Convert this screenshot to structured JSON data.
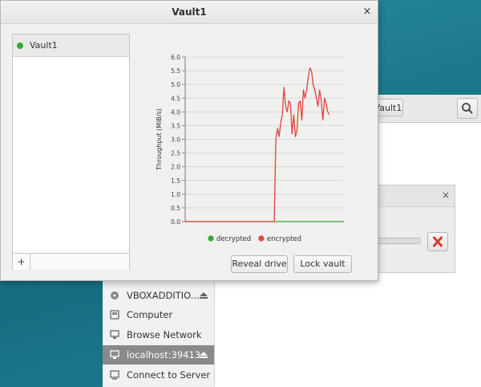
{
  "window": {
    "title": "Vault1",
    "close_glyph": "×"
  },
  "vault_list": {
    "items": [
      {
        "name": "Vault1",
        "status_color": "#33a83a"
      }
    ],
    "add_label": "+"
  },
  "chart_data": {
    "type": "line",
    "ylabel": "Throughput (MiB/s)",
    "xlabel": "",
    "ylim": [
      0,
      6
    ],
    "yticks": [
      "0.0",
      "0.5",
      "1.0",
      "1.5",
      "2.0",
      "2.5",
      "3.0",
      "3.5",
      "4.0",
      "4.5",
      "5.0",
      "5.5",
      "6.0"
    ],
    "grid": true,
    "legend": "bottom",
    "x": [
      0,
      1,
      2,
      3,
      4,
      5,
      6,
      7,
      8,
      9,
      10,
      11,
      12,
      13,
      14,
      15,
      16,
      17,
      18,
      19,
      20,
      21,
      22,
      23,
      24,
      25,
      26,
      27,
      28,
      29,
      30,
      31,
      32,
      33,
      34,
      35,
      36,
      37,
      38,
      39,
      40,
      41,
      42,
      43,
      44,
      45,
      46,
      47,
      48,
      49,
      50,
      51,
      52,
      53,
      54,
      55,
      56,
      57,
      58,
      59,
      60,
      61,
      62,
      63,
      64,
      65,
      66,
      67,
      68,
      69,
      70,
      71,
      72,
      73,
      74,
      75,
      76,
      77,
      78,
      79,
      80,
      81,
      82,
      83,
      84,
      85,
      86,
      87,
      88,
      89,
      90,
      91,
      92,
      93,
      94,
      95,
      96,
      97,
      98
    ],
    "series": [
      {
        "name": "decrypted",
        "color": "#33a83a",
        "values": [
          0,
          0,
          0,
          0,
          0,
          0,
          0,
          0,
          0,
          0,
          0,
          0,
          0,
          0,
          0,
          0,
          0,
          0,
          0,
          0,
          0,
          0,
          0,
          0,
          0,
          0,
          0,
          0,
          0,
          0,
          0,
          0,
          0,
          0,
          0,
          0,
          0,
          0,
          0,
          0,
          0,
          0,
          0,
          0,
          0,
          0,
          0,
          0,
          0,
          0,
          0,
          0,
          0,
          0,
          0,
          0,
          0,
          0,
          0,
          0,
          0,
          0,
          0,
          0,
          0,
          0,
          0,
          0,
          0,
          0,
          0,
          0,
          0,
          0,
          0,
          0,
          0,
          0,
          0,
          0,
          0,
          0,
          0,
          0,
          0,
          0,
          0,
          0,
          0,
          0,
          0,
          0,
          0,
          0,
          0,
          0,
          0,
          0,
          0
        ]
      },
      {
        "name": "encrypted",
        "color": "#e0433a",
        "values": [
          0,
          0,
          0,
          0,
          0,
          0,
          0,
          0,
          0,
          0,
          0,
          0,
          0,
          0,
          0,
          0,
          0,
          0,
          0,
          0,
          0,
          0,
          0,
          0,
          0,
          0,
          0,
          0,
          0,
          0,
          0,
          0,
          0,
          0,
          0,
          0,
          0,
          0,
          0,
          0,
          0,
          0,
          0,
          0,
          0,
          0,
          0,
          0,
          0,
          0,
          0,
          0,
          0,
          0,
          0,
          0,
          3.0,
          3.4,
          3.1,
          3.6,
          3.9,
          4.9,
          4.2,
          4.0,
          4.4,
          4.3,
          3.2,
          3.9,
          3.1,
          3.3,
          4.3,
          4.4,
          3.7,
          4.8,
          4.5,
          4.8,
          5.3,
          5.6,
          5.5,
          5.0,
          4.8,
          4.5,
          4.2,
          4.8,
          4.4,
          3.7,
          4.5,
          4.3,
          4.0,
          3.9
        ]
      }
    ]
  },
  "buttons": {
    "reveal": "Reveal drive",
    "lock": "Lock vault"
  },
  "file_manager": {
    "path_button": "Vault1",
    "places": [
      {
        "label": "VBOXADDITIO...",
        "icon": "optical-disc-icon",
        "eject": true,
        "active": false
      },
      {
        "label": "Computer",
        "icon": "computer-icon",
        "eject": false,
        "active": false
      },
      {
        "label": "Browse Network",
        "icon": "network-icon",
        "eject": false,
        "active": false
      },
      {
        "label": "localhost:39413",
        "icon": "network-drive-icon",
        "eject": true,
        "active": true
      },
      {
        "label": "Connect to Server",
        "icon": "server-icon",
        "eject": false,
        "active": false
      }
    ]
  },
  "progress_dialog": {
    "close_glyph": "×"
  }
}
